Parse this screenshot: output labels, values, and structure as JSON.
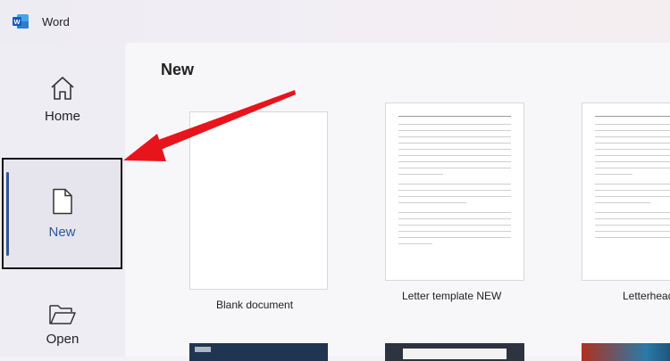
{
  "app": {
    "title": "Word"
  },
  "sidebar": {
    "items": [
      {
        "label": "Home",
        "icon": "home-icon"
      },
      {
        "label": "New",
        "icon": "new-document-icon",
        "selected": true
      },
      {
        "label": "Open",
        "icon": "folder-open-icon"
      }
    ]
  },
  "main": {
    "section_title": "New",
    "templates": [
      {
        "caption": "Blank document"
      },
      {
        "caption": "Letter template NEW"
      },
      {
        "caption": "Letterhead"
      }
    ]
  },
  "colors": {
    "accent": "#2b579a",
    "arrow": "#e8141c",
    "highlight_box": "#111111"
  }
}
